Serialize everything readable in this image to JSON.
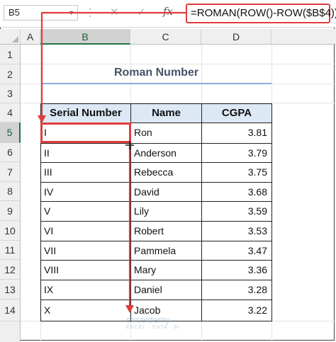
{
  "formula_bar": {
    "name_box": "B5",
    "more_icon": "⋮",
    "cancel_icon": "✕",
    "enter_icon": "✓",
    "fx_label": "fx",
    "formula": "=ROMAN(ROW()-ROW($B$4))"
  },
  "columns": [
    "A",
    "B",
    "C",
    "D"
  ],
  "rows": [
    "1",
    "2",
    "3",
    "4",
    "5",
    "6",
    "7",
    "8",
    "9",
    "10",
    "11",
    "12",
    "13",
    "14"
  ],
  "sheet": {
    "title": "Roman Number",
    "headers": [
      "Serial Number",
      "Name",
      "CGPA"
    ],
    "data": [
      [
        "I",
        "Ron",
        "3.81"
      ],
      [
        "II",
        "Anderson",
        "3.79"
      ],
      [
        "III",
        "Rebecca",
        "3.75"
      ],
      [
        "IV",
        "David",
        "3.68"
      ],
      [
        "V",
        "Lily",
        "3.59"
      ],
      [
        "VI",
        "Robert",
        "3.53"
      ],
      [
        "VII",
        "Pammela",
        "3.47"
      ],
      [
        "VIII",
        "Mary",
        "3.36"
      ],
      [
        "IX",
        "Daniel",
        "3.28"
      ],
      [
        "X",
        "Jacob",
        "3.22"
      ]
    ]
  },
  "watermark": {
    "name": "exceldemy",
    "tagline": "EXCEL · DATA · BI"
  },
  "colors": {
    "accent": "#e03c3c",
    "header_fill": "#dce9f5",
    "title": "#44546a"
  }
}
